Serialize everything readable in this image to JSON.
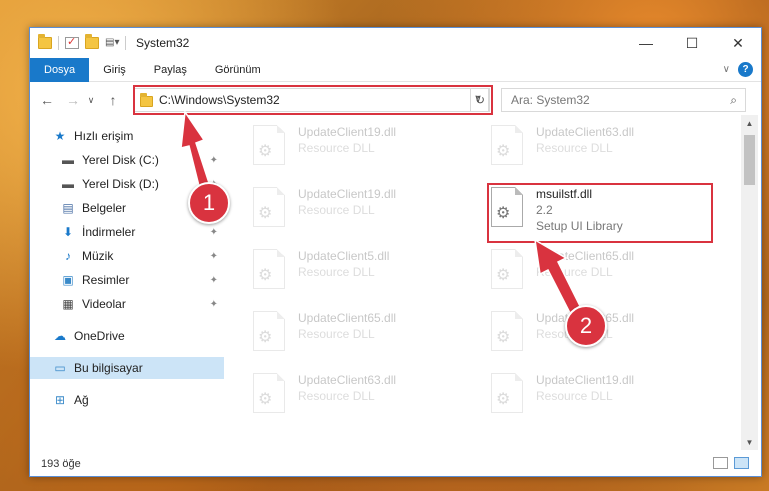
{
  "window": {
    "title": "System32",
    "min_symbol": "—",
    "max_symbol": "☐",
    "close_symbol": "✕"
  },
  "ribbon": {
    "tabs": [
      "Dosya",
      "Giriş",
      "Paylaş",
      "Görünüm"
    ],
    "help_symbol": "?",
    "expand_symbol": "∨"
  },
  "nav": {
    "back_symbol": "←",
    "forward_symbol": "→",
    "recent_symbol": "∨",
    "up_symbol": "↑",
    "address": "C:\\Windows\\System32",
    "address_dropdown": "∨",
    "refresh_symbol": "↻",
    "search_placeholder": "Ara: System32",
    "search_symbol": "⌕"
  },
  "sidebar": {
    "items": [
      {
        "label": "Hızlı erişim",
        "icon": "star-icon",
        "glyph": "★",
        "color": "#1979ca",
        "pinned": false
      },
      {
        "label": "Yerel Disk (C:)",
        "icon": "drive-icon",
        "glyph": "▬",
        "color": "#555555",
        "pinned": true
      },
      {
        "label": "Yerel Disk (D:)",
        "icon": "drive-icon",
        "glyph": "▬",
        "color": "#555555",
        "pinned": true
      },
      {
        "label": "Belgeler",
        "icon": "documents-icon",
        "glyph": "▤",
        "color": "#4a6fa5",
        "pinned": true
      },
      {
        "label": "İndirmeler",
        "icon": "download-icon",
        "glyph": "⬇",
        "color": "#1979ca",
        "pinned": true
      },
      {
        "label": "Müzik",
        "icon": "music-icon",
        "glyph": "♪",
        "color": "#1979ca",
        "pinned": true
      },
      {
        "label": "Resimler",
        "icon": "pictures-icon",
        "glyph": "▣",
        "color": "#3a8ac9",
        "pinned": true
      },
      {
        "label": "Videolar",
        "icon": "video-icon",
        "glyph": "▦",
        "color": "#444444",
        "pinned": true
      },
      {
        "label": "OneDrive",
        "icon": "cloud-icon",
        "glyph": "☁",
        "color": "#1979ca",
        "pinned": false
      },
      {
        "label": "Bu bilgisayar",
        "icon": "computer-icon",
        "glyph": "▭",
        "color": "#3a8ac9",
        "pinned": false
      },
      {
        "label": "Ağ",
        "icon": "network-icon",
        "glyph": "⊞",
        "color": "#3a8ac9",
        "pinned": false
      }
    ],
    "pin_symbol": "✦"
  },
  "files": {
    "left": [
      {
        "name": "UpdateClient19.dll",
        "sub": "Resource DLL"
      },
      {
        "name": "UpdateClient19.dll",
        "sub": "Resource DLL"
      },
      {
        "name": "UpdateClient5.dll",
        "sub": "Resource DLL"
      },
      {
        "name": "UpdateClient65.dll",
        "sub": "Resource DLL"
      },
      {
        "name": "UpdateClient63.dll",
        "sub": "Resource DLL"
      }
    ],
    "right": [
      {
        "name": "UpdateClient63.dll",
        "sub": "Resource DLL"
      },
      {
        "name": "msuilstf.dll",
        "sub": "2.2",
        "sub2": "Setup UI Library"
      },
      {
        "name": "UpdateClient65.dll",
        "sub": "Resource DLL"
      },
      {
        "name": "UpdateClient65.dll",
        "sub": "Resource DLL"
      },
      {
        "name": "UpdateClient19.dll",
        "sub": "Resource DLL"
      }
    ],
    "gear_symbol": "⚙"
  },
  "status": {
    "count": "193 öğe"
  },
  "callouts": [
    {
      "label": "1",
      "color": "#d9333f"
    },
    {
      "label": "2",
      "color": "#d9333f"
    }
  ]
}
